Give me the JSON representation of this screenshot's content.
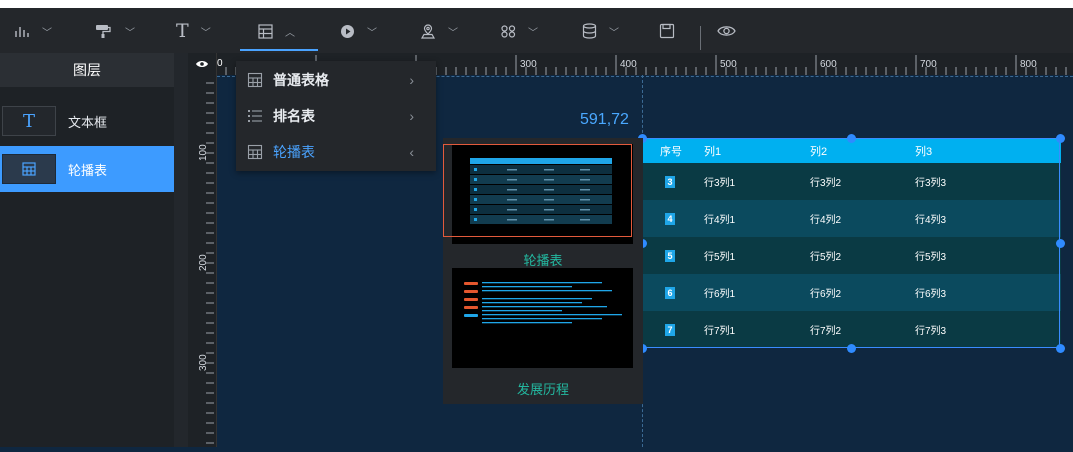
{
  "toolbar": {
    "items": [
      {
        "name": "chart-icon",
        "chevron": "﹀"
      },
      {
        "name": "paint-roller-icon",
        "chevron": "﹀"
      },
      {
        "name": "text-icon",
        "glyph": "T",
        "chevron": "﹀"
      },
      {
        "name": "table-icon",
        "chevron": "︿"
      },
      {
        "name": "media-icon",
        "chevron": "﹀"
      },
      {
        "name": "map-pin-icon",
        "chevron": "﹀"
      },
      {
        "name": "widget-icon",
        "chevron": "﹀"
      },
      {
        "name": "database-icon",
        "chevron": "﹀"
      },
      {
        "name": "save-icon"
      },
      {
        "name": "eye-icon"
      }
    ]
  },
  "sidebar": {
    "title": "图层",
    "layers": [
      {
        "label": "文本框",
        "icon": "T",
        "icon_name": "text-icon",
        "active": false
      },
      {
        "label": "轮播表",
        "icon": "▦",
        "icon_name": "table-icon",
        "active": true
      }
    ]
  },
  "ruler": {
    "corner_value": "0",
    "h_labels": [
      "300",
      "400",
      "500",
      "600",
      "700",
      "800"
    ],
    "v_labels": [
      "100",
      "200",
      "300"
    ]
  },
  "canvas": {
    "coord_readout": "591,72"
  },
  "table_menu": {
    "items": [
      {
        "label": "普通表格",
        "icon": "table-icon",
        "arrow": "›"
      },
      {
        "label": "排名表",
        "icon": "list-icon",
        "arrow": "›"
      },
      {
        "label": "轮播表",
        "icon": "table-icon",
        "arrow": "‹",
        "active": true
      }
    ]
  },
  "submenu": {
    "items": [
      {
        "label": "轮播表",
        "selected": true
      },
      {
        "label": "发展历程",
        "selected": false
      }
    ]
  },
  "scroll_table": {
    "header": [
      "序号",
      "列1",
      "列2",
      "列3"
    ],
    "header_color": "#00b0f0",
    "rows": [
      {
        "index": "3",
        "cells": [
          "行3列1",
          "行3列2",
          "行3列3"
        ]
      },
      {
        "index": "4",
        "cells": [
          "行4列1",
          "行4列2",
          "行4列3"
        ]
      },
      {
        "index": "5",
        "cells": [
          "行5列1",
          "行5列2",
          "行5列3"
        ]
      },
      {
        "index": "6",
        "cells": [
          "行6列1",
          "行6列2",
          "行6列3"
        ]
      },
      {
        "index": "7",
        "cells": [
          "行7列1",
          "行7列2",
          "行7列3"
        ]
      }
    ],
    "row_colors": [
      "#0a3a44",
      "#0b4a5e"
    ]
  },
  "colors": {
    "accent": "#3d9bff",
    "canvas_bg": "#0f2740",
    "coord": "#4aa8ff",
    "submenu_label": "#23b8a0"
  }
}
